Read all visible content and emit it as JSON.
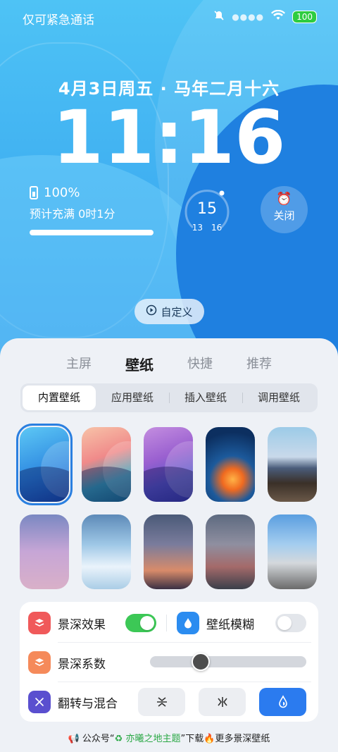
{
  "status": {
    "carrier": "仅可紧急通话",
    "battery": "100"
  },
  "lock": {
    "date": "4月3日周五 · 马年二月十六",
    "time": "11:16",
    "charge_percent": "100%",
    "charge_text": "预计充满 0时1分",
    "charge_level": 1.0,
    "weather_temp": "15",
    "weather_low": "13",
    "weather_high": "16",
    "alarm_label": "关闭",
    "custom_label": "自定义"
  },
  "tabs": [
    "主屏",
    "壁纸",
    "快捷",
    "推荐"
  ],
  "active_tab": "壁纸",
  "segments": [
    "内置壁纸",
    "应用壁纸",
    "插入壁纸",
    "调用壁纸"
  ],
  "selected_segment": "内置壁纸",
  "settings": {
    "depth_effect": "景深效果",
    "wallpaper_blur": "壁纸模糊",
    "depth_factor": "景深系数",
    "flip_blend": "翻转与混合"
  },
  "slider_level": 0.3,
  "footer": {
    "prefix": "公众号“",
    "name": "亦曦之地主题",
    "suffix": "”下载🔥更多景深壁纸"
  },
  "colors": {
    "accent": "#2b7bef",
    "toggle_on": "#3cc856"
  }
}
